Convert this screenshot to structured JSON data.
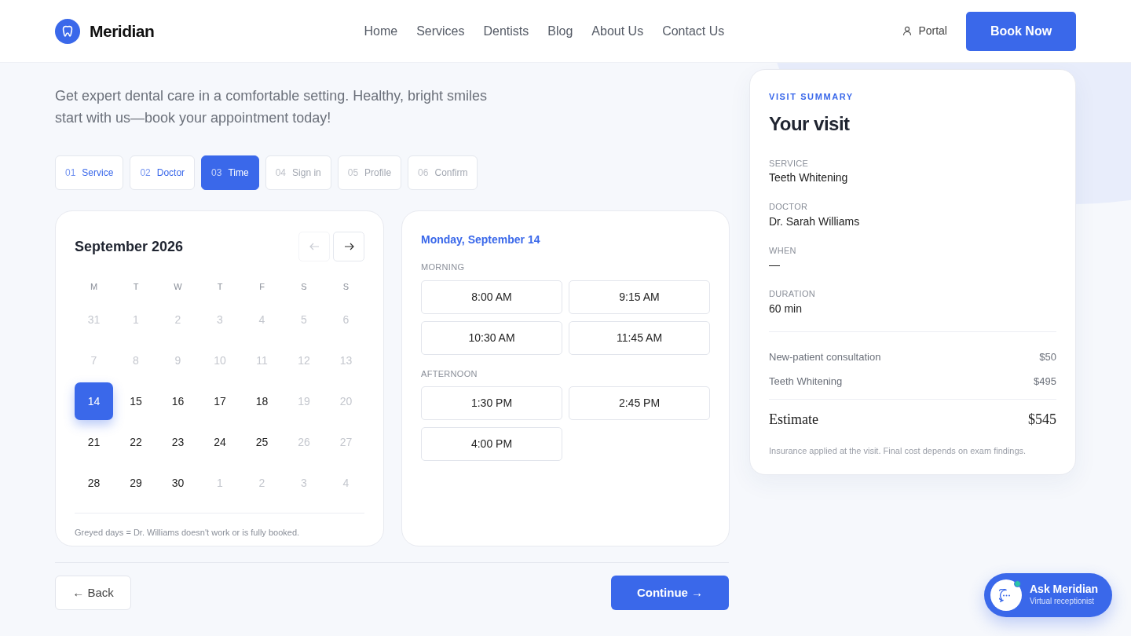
{
  "brand": {
    "name": "Meridian"
  },
  "nav": {
    "links": [
      {
        "label": "Home"
      },
      {
        "label": "Services"
      },
      {
        "label": "Dentists"
      },
      {
        "label": "Blog"
      },
      {
        "label": "About Us"
      },
      {
        "label": "Contact Us"
      }
    ],
    "portal": "Portal",
    "cta": "Book Now"
  },
  "hero": {
    "subtitle": "Get expert dental care in a comfortable setting. Healthy, bright smiles start with us—book your appointment today!"
  },
  "steps": [
    {
      "number": "01",
      "label": "Service",
      "completed": true,
      "selected": false
    },
    {
      "number": "02",
      "label": "Doctor",
      "completed": true,
      "selected": false
    },
    {
      "number": "03",
      "label": "Time",
      "completed": false,
      "selected": true
    },
    {
      "number": "04",
      "label": "Sign in",
      "completed": false,
      "selected": false
    },
    {
      "number": "05",
      "label": "Profile",
      "completed": false,
      "selected": false
    },
    {
      "number": "06",
      "label": "Confirm",
      "completed": false,
      "selected": false
    }
  ],
  "calendar": {
    "month": "September 2026",
    "prev_disabled": true,
    "weekdays": [
      "M",
      "T",
      "W",
      "T",
      "F",
      "S",
      "S"
    ],
    "days": [
      {
        "text": "31",
        "muted": true,
        "selected": false
      },
      {
        "text": "1",
        "muted": true,
        "selected": false
      },
      {
        "text": "2",
        "muted": true,
        "selected": false
      },
      {
        "text": "3",
        "muted": true,
        "selected": false
      },
      {
        "text": "4",
        "muted": true,
        "selected": false
      },
      {
        "text": "5",
        "muted": true,
        "selected": false
      },
      {
        "text": "6",
        "muted": true,
        "selected": false
      },
      {
        "text": "7",
        "muted": true,
        "selected": false
      },
      {
        "text": "8",
        "muted": true,
        "selected": false
      },
      {
        "text": "9",
        "muted": true,
        "selected": false
      },
      {
        "text": "10",
        "muted": true,
        "selected": false
      },
      {
        "text": "11",
        "muted": true,
        "selected": false
      },
      {
        "text": "12",
        "muted": true,
        "selected": false
      },
      {
        "text": "13",
        "muted": true,
        "selected": false
      },
      {
        "text": "14",
        "muted": false,
        "selected": true
      },
      {
        "text": "15",
        "muted": false,
        "selected": false
      },
      {
        "text": "16",
        "muted": false,
        "selected": false
      },
      {
        "text": "17",
        "muted": false,
        "selected": false
      },
      {
        "text": "18",
        "muted": false,
        "selected": false
      },
      {
        "text": "19",
        "muted": true,
        "selected": false
      },
      {
        "text": "20",
        "muted": true,
        "selected": false
      },
      {
        "text": "21",
        "muted": false,
        "selected": false
      },
      {
        "text": "22",
        "muted": false,
        "selected": false
      },
      {
        "text": "23",
        "muted": false,
        "selected": false
      },
      {
        "text": "24",
        "muted": false,
        "selected": false
      },
      {
        "text": "25",
        "muted": false,
        "selected": false
      },
      {
        "text": "26",
        "muted": true,
        "selected": false
      },
      {
        "text": "27",
        "muted": true,
        "selected": false
      },
      {
        "text": "28",
        "muted": false,
        "selected": false
      },
      {
        "text": "29",
        "muted": false,
        "selected": false
      },
      {
        "text": "30",
        "muted": false,
        "selected": false
      },
      {
        "text": "1",
        "muted": true,
        "selected": false
      },
      {
        "text": "2",
        "muted": true,
        "selected": false
      },
      {
        "text": "3",
        "muted": true,
        "selected": false
      },
      {
        "text": "4",
        "muted": true,
        "selected": false
      }
    ],
    "note": "Greyed days = Dr. Williams doesn't work or is fully booked."
  },
  "times": {
    "date": "Monday, September 14",
    "groups": [
      {
        "label": "MORNING",
        "slots": [
          {
            "text": "8:00 AM",
            "selected": false
          },
          {
            "text": "9:15 AM",
            "selected": false
          },
          {
            "text": "10:30 AM",
            "selected": false
          },
          {
            "text": "11:45 AM",
            "selected": false
          }
        ]
      },
      {
        "label": "AFTERNOON",
        "slots": [
          {
            "text": "1:30 PM",
            "selected": false
          },
          {
            "text": "2:45 PM",
            "selected": false
          },
          {
            "text": "4:00 PM",
            "selected": false
          }
        ]
      }
    ]
  },
  "actions": {
    "back": "← Back",
    "continue": "Continue →"
  },
  "summary": {
    "eyebrow": "VISIT SUMMARY",
    "title": "Your visit",
    "fields": [
      {
        "label": "SERVICE",
        "value": "Teeth Whitening"
      },
      {
        "label": "DOCTOR",
        "value": "Dr. Sarah Williams"
      },
      {
        "label": "WHEN",
        "value": "—"
      },
      {
        "label": "DURATION",
        "value": "60 min"
      }
    ],
    "lines": [
      {
        "label": "New-patient consultation",
        "amount": "$50"
      },
      {
        "label": "Teeth Whitening",
        "amount": "$495"
      }
    ],
    "total": {
      "label": "Estimate",
      "amount": "$545"
    },
    "note": "Insurance applied at the visit. Final cost depends on exam findings."
  },
  "chat": {
    "title": "Ask Meridian",
    "subtitle": "Virtual receptionist",
    "online": true
  }
}
